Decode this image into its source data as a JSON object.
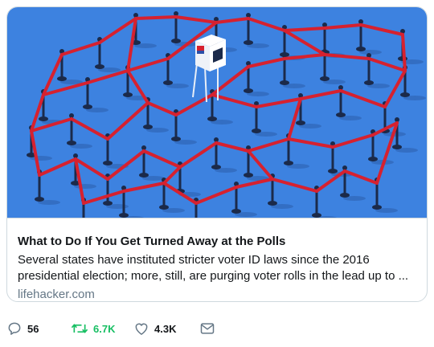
{
  "link_card": {
    "image_alt": "Voting booth surrounded by stanchions and red ropes forming a maze",
    "title": "What to Do If You Get Turned Away at the Polls",
    "description": "Several states have instituted stricter voter ID laws since the 2016 presidential election; more, still, are purging voter rolls in the lead up to ...",
    "domain": "lifehacker.com"
  },
  "actions": {
    "reply": {
      "icon": "reply-icon",
      "count": "56"
    },
    "retweet": {
      "icon": "retweet-icon",
      "count": "6.7K",
      "color": "#17bf63"
    },
    "like": {
      "icon": "heart-icon",
      "count": "4.3K"
    },
    "share": {
      "icon": "mail-icon"
    }
  },
  "colors": {
    "image_bg": "#3d82e0",
    "rope": "#d6212f",
    "post": "#1b2a4a",
    "border": "#cfd9de",
    "muted": "#657786"
  }
}
